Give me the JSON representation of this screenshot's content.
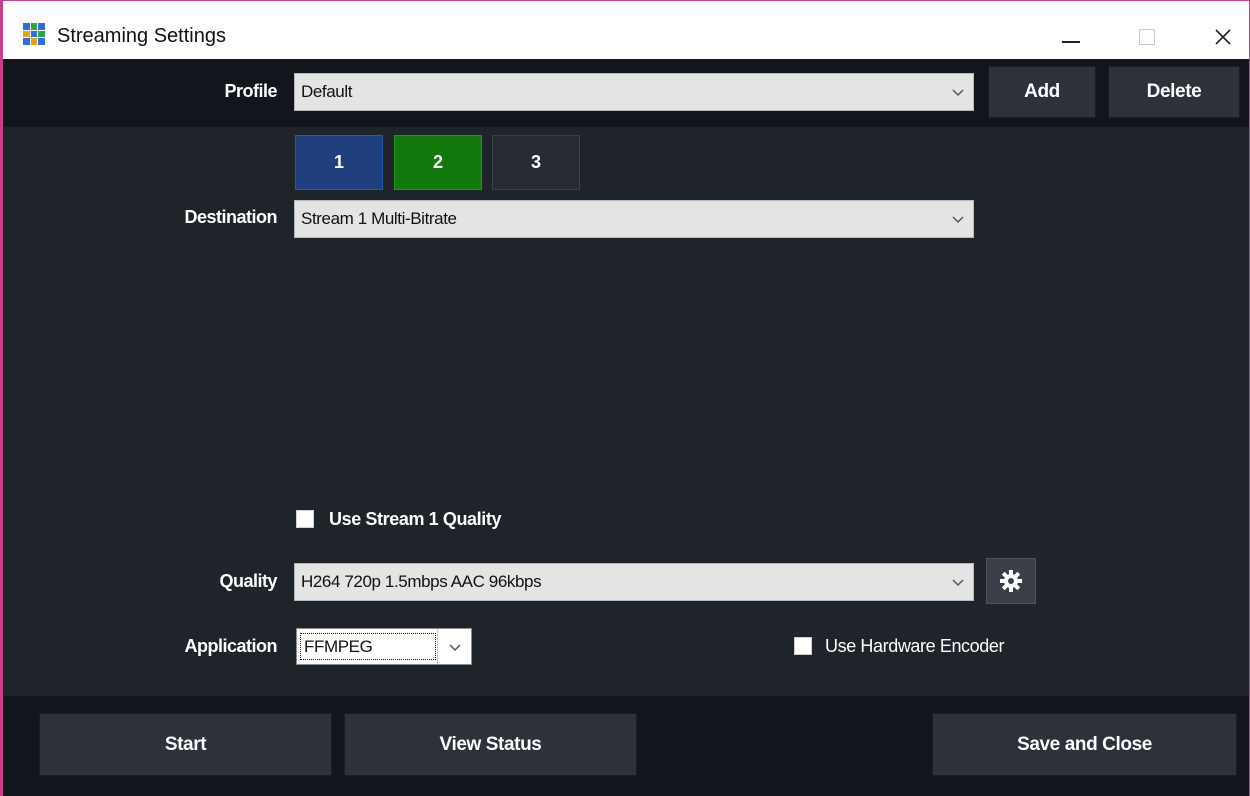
{
  "window": {
    "title": "Streaming Settings",
    "icon": "app-grid-icon"
  },
  "profile": {
    "label": "Profile",
    "value": "Default",
    "add_label": "Add",
    "delete_label": "Delete"
  },
  "stream_tabs": [
    {
      "label": "1",
      "color": "#1f3f7e"
    },
    {
      "label": "2",
      "color": "#13790e"
    },
    {
      "label": "3",
      "color": "#262a31"
    }
  ],
  "destination": {
    "label": "Destination",
    "value": "Stream 1 Multi-Bitrate"
  },
  "use_stream1_quality": {
    "label": "Use Stream 1 Quality",
    "checked": false
  },
  "quality": {
    "label": "Quality",
    "value": "H264 720p 1.5mbps AAC 96kbps",
    "settings_icon": "gear-icon"
  },
  "application": {
    "label": "Application",
    "value": "FFMPEG"
  },
  "hardware_encoder": {
    "label": "Use Hardware Encoder",
    "checked": false
  },
  "footer": {
    "start_label": "Start",
    "view_status_label": "View Status",
    "save_close_label": "Save and Close"
  },
  "colors": {
    "window_bg": "#1f232a",
    "bar_bg": "#12151b",
    "button_bg": "#2d323a",
    "accent_border": "#c8408a"
  }
}
